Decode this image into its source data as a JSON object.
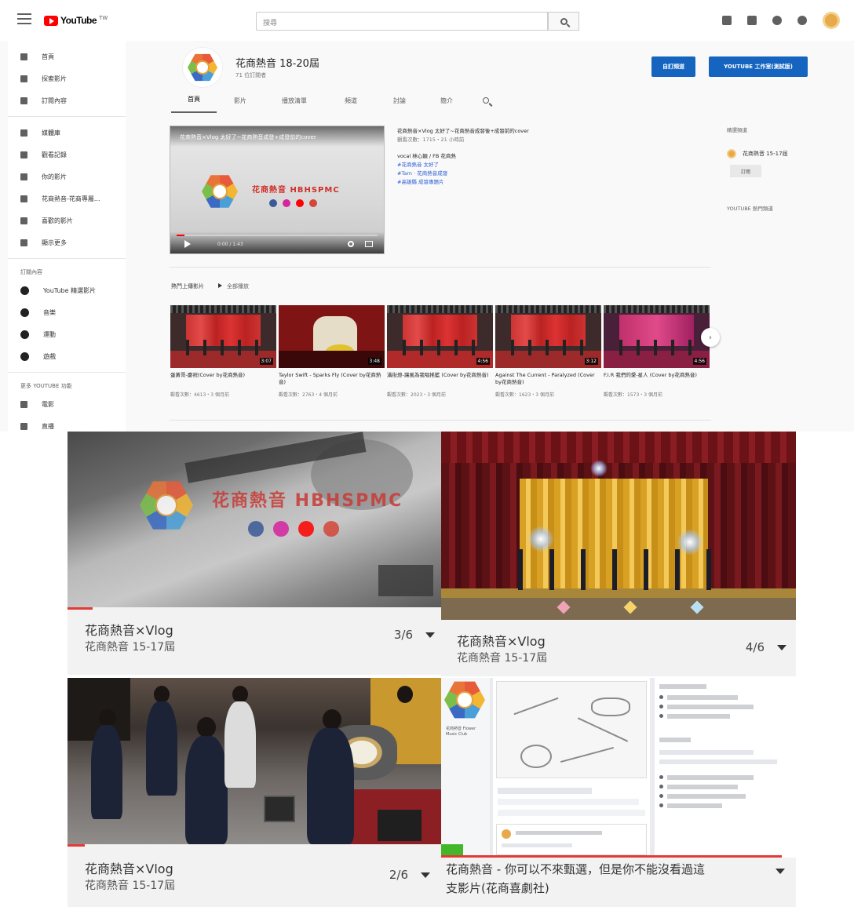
{
  "youtube": {
    "logo_word": "YouTube",
    "logo_sup": "TW",
    "search_placeholder": "搜尋",
    "sidebar": {
      "items_top": [
        {
          "label": "首頁"
        },
        {
          "label": "探索影片"
        },
        {
          "label": "訂閱內容"
        }
      ],
      "items_library": [
        {
          "label": "媒體庫"
        },
        {
          "label": "觀看記錄"
        },
        {
          "label": "你的影片"
        },
        {
          "label": "花商熱音-花商專屬..."
        },
        {
          "label": "喜歡的影片"
        },
        {
          "label": "顯示更多"
        }
      ],
      "subscriptions_header": "訂閱內容",
      "subscriptions": [
        {
          "label": "YouTube 精選影片"
        },
        {
          "label": "音樂"
        },
        {
          "label": "運動"
        },
        {
          "label": "遊戲"
        }
      ],
      "more_header": "更多 YOUTUBE 功能",
      "more": [
        {
          "label": "電影"
        },
        {
          "label": "直播"
        }
      ]
    },
    "channel": {
      "name": "花商熱音 18-20屆",
      "subscribers": "71 位訂閱者",
      "btn_customize": "自訂頻道",
      "btn_studio": "YOUTUBE 工作室(測試版)",
      "tabs": [
        "首頁",
        "影片",
        "播放清單",
        "頻道",
        "討論",
        "簡介"
      ]
    },
    "hero": {
      "player_title": "花商熱音×Vlog 太好了~花商熱音成發+成發前的cover",
      "brand": "花商熱音 HBHSPMC",
      "time": "0:00 / 1:43",
      "title": "花商熱音×Vlog 太好了~花商熱音成發後+成發前的cover",
      "meta": "觀看次數：1715・21 小時前",
      "lines": [
        "vocal 林心穎 / FB 花商熱",
        "#花商熱音 太好了",
        "#Tarn · 花商熱音成發",
        "#高雄縣 成發專題片"
      ]
    },
    "right": {
      "header": "精選頻道",
      "channel_name": "花商熱音 15-17屆",
      "subscribe_label": "訂閱",
      "footer": "YOUTUBE 熱門頻道"
    },
    "shelf": {
      "title": "熱門上傳影片",
      "play_all": "全部播放",
      "videos": [
        {
          "title": "蛋黃哥-慶祝(Cover by花商熱音)",
          "meta": "觀看次數：4613・3 個月前",
          "duration": "3:07"
        },
        {
          "title": "Taylor Swift - Sparks Fly (Cover by花商熱音)",
          "meta": "觀看次數：2763・4 個月前",
          "duration": "3:48"
        },
        {
          "title": "滿街燈-讓風為我唱搖籃 (Cover by花商熱音)",
          "meta": "觀看次數：2023・3 個月前",
          "duration": "4:56"
        },
        {
          "title": "Against The Current - Paralyzed (Cover by花商熱音)",
          "meta": "觀看次數：1623・3 個月前",
          "duration": "3:12"
        },
        {
          "title": "F.I.R 我們的愛-星人 (Cover by花商熱音)",
          "meta": "觀看次數：1573・3 個月前",
          "duration": "4:56"
        }
      ]
    }
  },
  "cards": [
    {
      "title": "花商熱音×Vlog",
      "channel": "花商熱音 15-17屆",
      "index": "3/6",
      "brand": "花商熱音 HBHSPMC"
    },
    {
      "title": "花商熱音×Vlog",
      "channel": "花商熱音 15-17屆",
      "index": "4/6"
    },
    {
      "title": "花商熱音×Vlog",
      "channel": "花商熱音 15-17屆",
      "index": "2/6"
    },
    {
      "title": "花商熱音 - 你可以不來甄選，但是你不能沒看過這",
      "title2": "支影片(花商喜劇社)",
      "fb_name": "花商熱音 Flower Music Club"
    }
  ],
  "colors": {
    "youtube_red": "#ff0000",
    "progress_red": "#e53935",
    "studio_blue": "#1565c0",
    "link_blue": "#2a5bd7"
  }
}
